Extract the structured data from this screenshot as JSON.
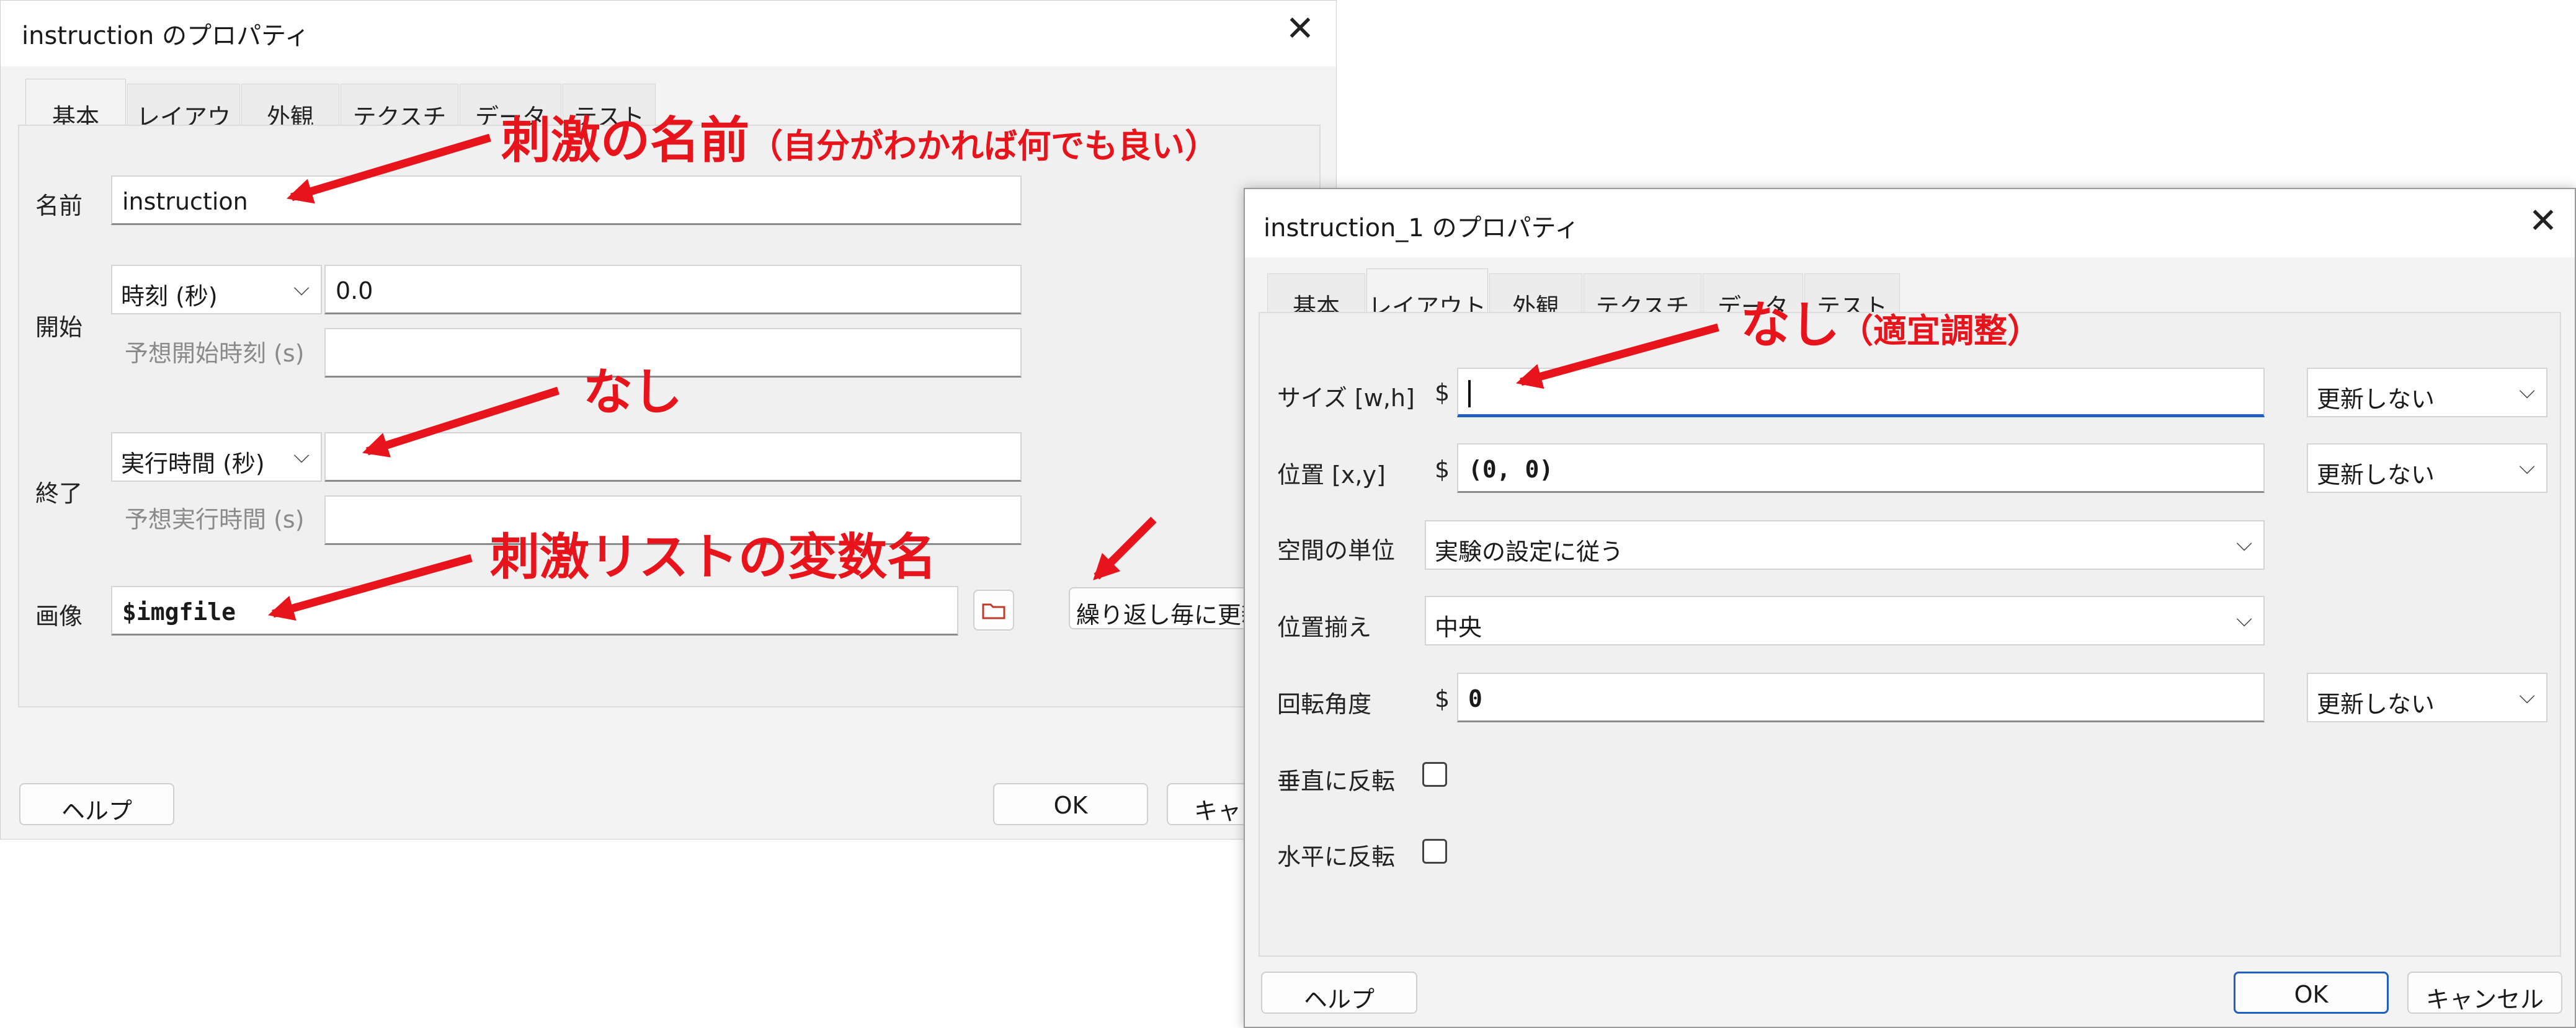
{
  "dialog1": {
    "title": "instruction のプロパティ",
    "close_glyph": "✕",
    "tabs": [
      "基本",
      "レイアウト",
      "外観",
      "テクスチャ",
      "データ",
      "テスト"
    ],
    "fields": {
      "name_label": "名前",
      "name_value": "instruction",
      "start_label": "開始",
      "start_type": "時刻 (秒)",
      "start_value": "0.0",
      "expected_start_label": "予想開始時刻 (s)",
      "end_label": "終了",
      "end_type": "実行時間 (秒)",
      "end_value": "",
      "expected_duration_label": "予想実行時間 (s)",
      "image_label": "画像",
      "image_value": "$imgfile",
      "update_button": "繰り返し毎に更新"
    },
    "buttons": {
      "help": "ヘルプ",
      "ok": "OK",
      "cancel": "キャンセル"
    }
  },
  "dialog2": {
    "title": "instruction_1 のプロパティ",
    "close_glyph": "✕",
    "tabs": [
      "基本",
      "レイアウト",
      "外観",
      "テクスチャ",
      "データ",
      "テスト"
    ],
    "active_tab": "レイアウト",
    "fields": {
      "size_label": "サイズ [w,h]",
      "size_value": "",
      "size_update": "更新しない",
      "pos_label": "位置 [x,y]",
      "pos_value": "(0, 0)",
      "pos_update": "更新しない",
      "units_label": "空間の単位",
      "units_value": "実験の設定に従う",
      "anchor_label": "位置揃え",
      "anchor_value": "中央",
      "ori_label": "回転角度",
      "ori_value": "0",
      "ori_update": "更新しない",
      "flipv_label": "垂直に反転",
      "fliph_label": "水平に反転",
      "dollar": "$"
    },
    "buttons": {
      "help": "ヘルプ",
      "ok": "OK",
      "cancel": "キャンセル"
    }
  },
  "annotations": {
    "name_main": "刺激の名前",
    "name_note": "（自分がわかれば何でも良い）",
    "end_note": "なし",
    "image_note": "刺激リストの変数名",
    "size_main": "なし",
    "size_note": "（適宜調整）"
  },
  "colors": {
    "annotation": "#e8141c",
    "focus": "#1f5fbf"
  },
  "icons": {
    "folder": "folder-icon",
    "chevron": "chevron-down-icon",
    "close": "close-icon"
  }
}
